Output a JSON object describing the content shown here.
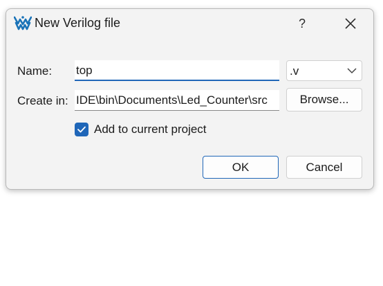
{
  "dialog": {
    "title": "New Verilog file",
    "help_label": "?",
    "icons": {
      "app": "gowin-logo-icon",
      "close": "close-icon",
      "dropdown": "chevron-down-icon",
      "check": "check-icon"
    }
  },
  "form": {
    "name_label": "Name:",
    "name_value": "top",
    "extension_value": ".v",
    "create_in_label": "Create in:",
    "create_in_value": "IDE\\bin\\Documents\\Led_Counter\\src",
    "browse_label": "Browse...",
    "add_to_project_label": "Add to current project",
    "add_to_project_checked": true
  },
  "buttons": {
    "ok_label": "OK",
    "cancel_label": "Cancel"
  },
  "colors": {
    "accent": "#1f66b8",
    "dialog_bg": "#f3f3f3"
  }
}
